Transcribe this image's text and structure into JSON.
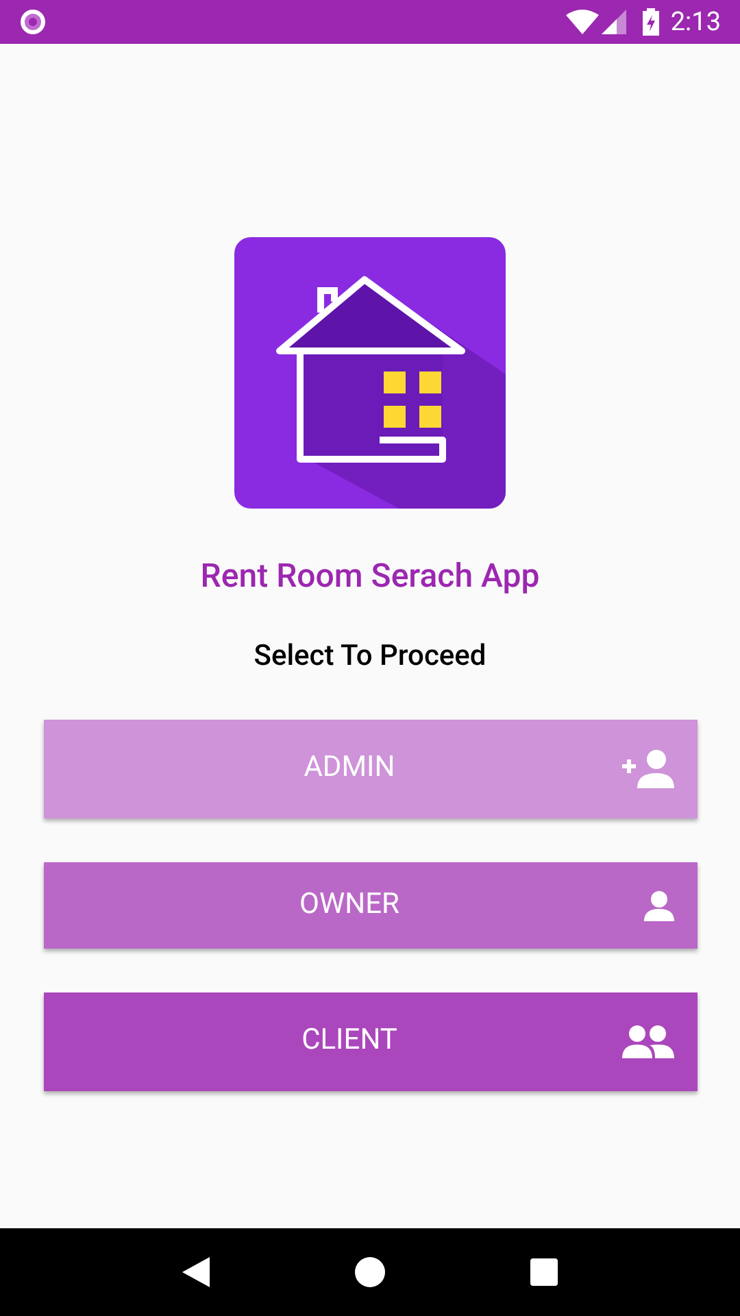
{
  "status_bar": {
    "time": "2:13"
  },
  "app_title": "Rent Room Serach App",
  "prompt": "Select To Proceed",
  "buttons": [
    {
      "label": "ADMIN",
      "kind": "add-person",
      "color": "#ce93d8"
    },
    {
      "label": "OWNER",
      "kind": "person",
      "color": "#ba68c8"
    },
    {
      "label": "CLIENT",
      "kind": "group",
      "color": "#ab47bc"
    }
  ]
}
